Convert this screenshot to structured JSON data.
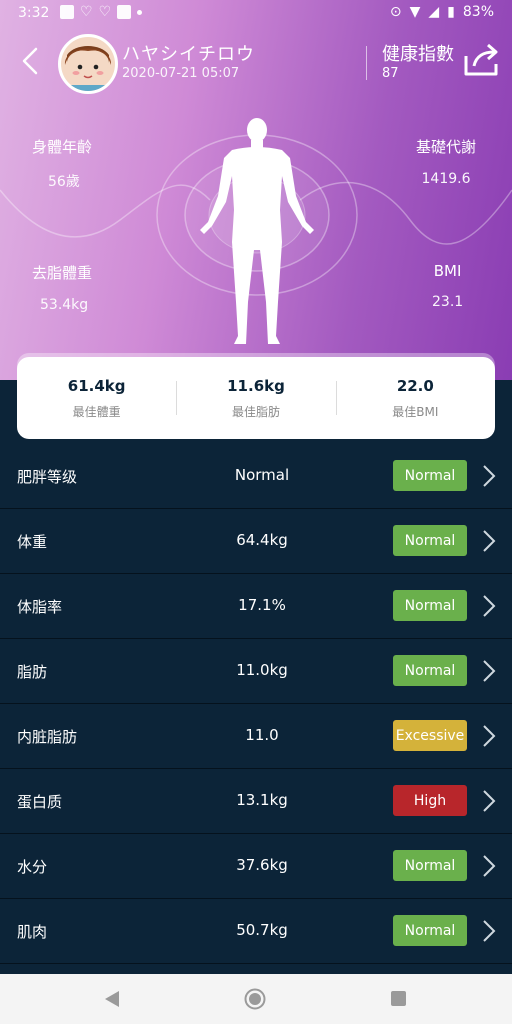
{
  "status_bar": {
    "time": "3:32",
    "battery": "83%"
  },
  "header": {
    "user_name": "ハヤシイチロウ",
    "date": "2020-07-21 05:07",
    "score_label": "健康指數",
    "score_value": "87"
  },
  "metrics": {
    "body_age": {
      "label": "身體年齡",
      "value": "56歲"
    },
    "bmr": {
      "label": "基礎代謝",
      "value": "1419.6"
    },
    "lean_mass": {
      "label": "去脂體重",
      "value": "53.4kg"
    },
    "bmi": {
      "label": "BMI",
      "value": "23.1"
    }
  },
  "summary_card": [
    {
      "value": "61.4kg",
      "label": "最佳體重"
    },
    {
      "value": "11.6kg",
      "label": "最佳脂肪"
    },
    {
      "value": "22.0",
      "label": "最佳BMI"
    }
  ],
  "rows": [
    {
      "name": "肥胖等级",
      "value": "Normal",
      "status": "Normal",
      "color": "#6ab04c"
    },
    {
      "name": "体重",
      "value": "64.4kg",
      "status": "Normal",
      "color": "#6ab04c"
    },
    {
      "name": "体脂率",
      "value": "17.1%",
      "status": "Normal",
      "color": "#6ab04c"
    },
    {
      "name": "脂肪",
      "value": "11.0kg",
      "status": "Normal",
      "color": "#6ab04c"
    },
    {
      "name": "内脏脂肪",
      "value": "11.0",
      "status": "Excessive",
      "color": "#d4b23a"
    },
    {
      "name": "蛋白质",
      "value": "13.1kg",
      "status": "High",
      "color": "#b8262b"
    },
    {
      "name": "水分",
      "value": "37.6kg",
      "status": "Normal",
      "color": "#6ab04c"
    },
    {
      "name": "肌肉",
      "value": "50.7kg",
      "status": "Normal",
      "color": "#6ab04c"
    }
  ],
  "colors": {
    "list_bg": "#0c2438",
    "normal": "#6ab04c",
    "excessive": "#d4b23a",
    "high": "#b8262b"
  }
}
